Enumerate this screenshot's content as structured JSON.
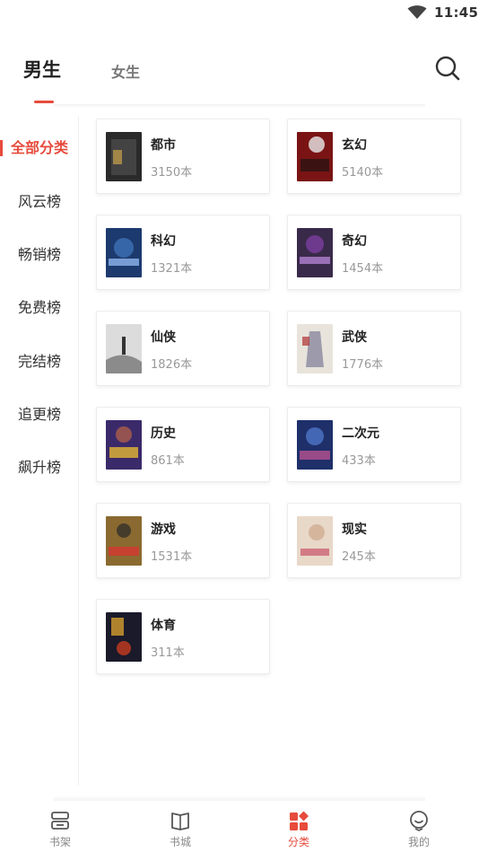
{
  "status_bar": {
    "time": "11:45",
    "wifi_icon": "wifi-icon"
  },
  "header": {
    "tabs": [
      {
        "label": "男生",
        "active": true
      },
      {
        "label": "女生",
        "active": false
      }
    ],
    "search_icon": "search-icon"
  },
  "sidebar": {
    "items": [
      {
        "label": "全部分类",
        "active": true
      },
      {
        "label": "风云榜"
      },
      {
        "label": "畅销榜"
      },
      {
        "label": "免费榜"
      },
      {
        "label": "完结榜"
      },
      {
        "label": "追更榜"
      },
      {
        "label": "飙升榜"
      }
    ]
  },
  "categories": [
    {
      "name": "都市",
      "count": "3150本",
      "cover_color": "#2a2a2a"
    },
    {
      "name": "玄幻",
      "count": "5140本",
      "cover_color": "#7a1414"
    },
    {
      "name": "科幻",
      "count": "1321本",
      "cover_color": "#1d3a6e"
    },
    {
      "name": "奇幻",
      "count": "1454本",
      "cover_color": "#3a2a4a"
    },
    {
      "name": "仙侠",
      "count": "1826本",
      "cover_color": "#dcdcdc"
    },
    {
      "name": "武侠",
      "count": "1776本",
      "cover_color": "#e8e4dc"
    },
    {
      "name": "历史",
      "count": "861本",
      "cover_color": "#3a2a6a"
    },
    {
      "name": "二次元",
      "count": "433本",
      "cover_color": "#1e2f6a"
    },
    {
      "name": "游戏",
      "count": "1531本",
      "cover_color": "#8a6a30"
    },
    {
      "name": "现实",
      "count": "245本",
      "cover_color": "#e8d8c8"
    },
    {
      "name": "体育",
      "count": "311本",
      "cover_color": "#1a1a2a"
    }
  ],
  "bottom_nav": [
    {
      "label": "书架",
      "icon": "bookshelf-icon",
      "active": false
    },
    {
      "label": "书城",
      "icon": "bookstore-icon",
      "active": false
    },
    {
      "label": "分类",
      "icon": "category-icon",
      "active": true
    },
    {
      "label": "我的",
      "icon": "profile-icon",
      "active": false
    }
  ],
  "colors": {
    "accent": "#e64b3c",
    "muted": "#999999"
  }
}
